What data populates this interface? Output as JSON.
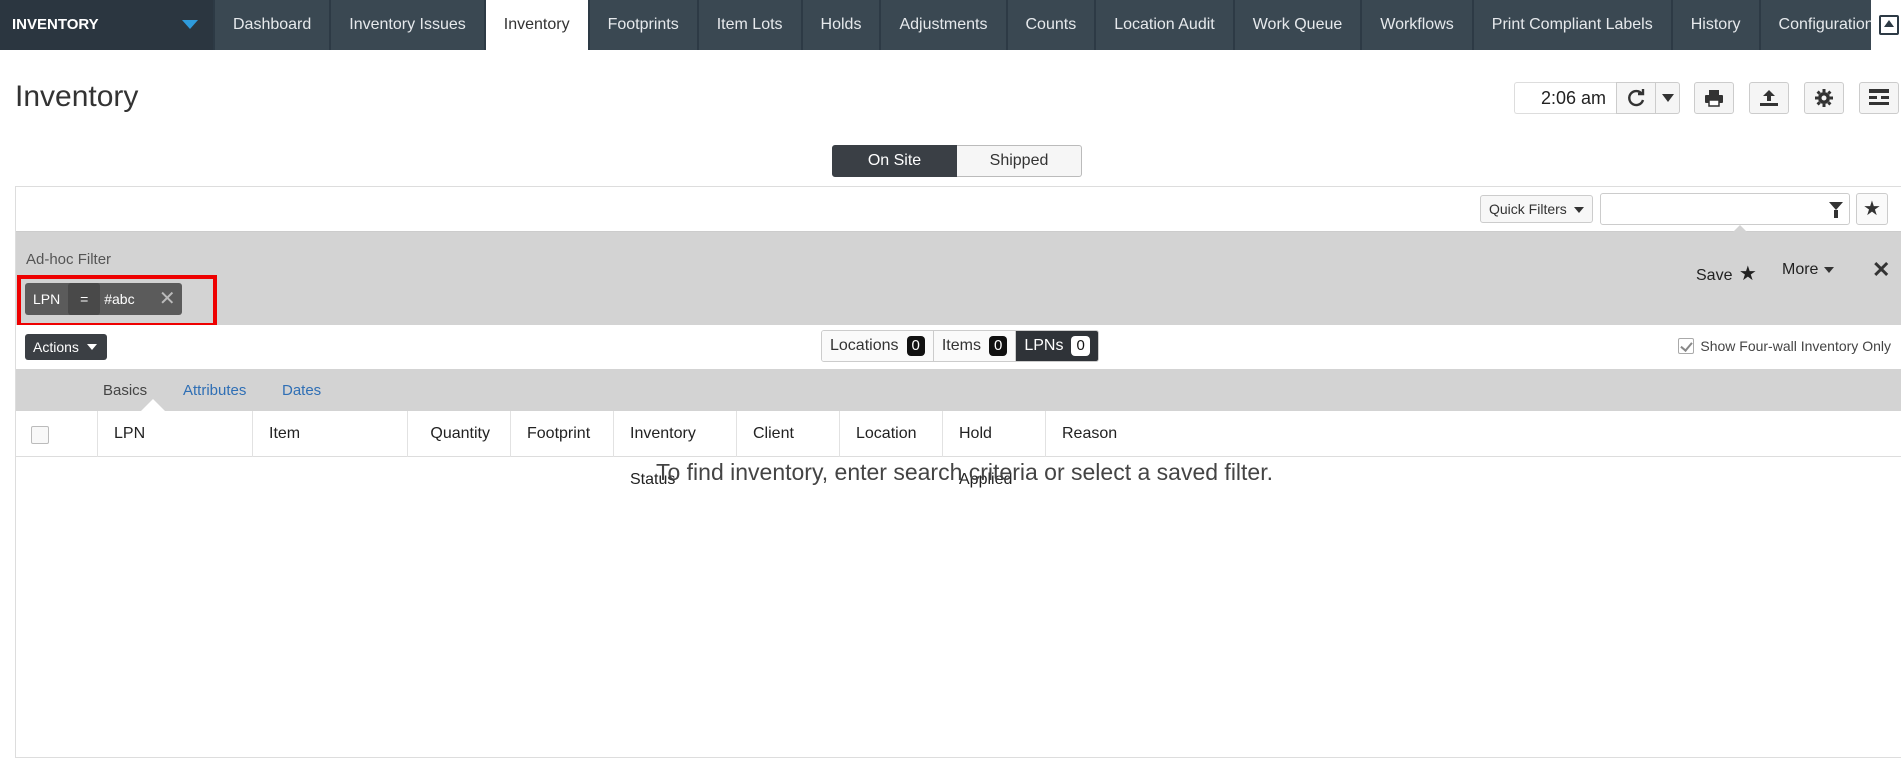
{
  "app": {
    "module_name": "INVENTORY"
  },
  "nav": {
    "tabs": [
      {
        "label": "Dashboard"
      },
      {
        "label": "Inventory Issues"
      },
      {
        "label": "Inventory"
      },
      {
        "label": "Footprints"
      },
      {
        "label": "Item Lots"
      },
      {
        "label": "Holds"
      },
      {
        "label": "Adjustments"
      },
      {
        "label": "Counts"
      },
      {
        "label": "Location Audit"
      },
      {
        "label": "Work Queue"
      },
      {
        "label": "Workflows"
      },
      {
        "label": "Print Compliant Labels"
      },
      {
        "label": "History"
      },
      {
        "label": "Configuration"
      }
    ],
    "active_tab": "Inventory",
    "more_glyph": "»"
  },
  "header": {
    "title": "Inventory",
    "time": "2:06 am"
  },
  "view_toggle": {
    "on_site": "On Site",
    "shipped": "Shipped",
    "selected": "On Site"
  },
  "filter_bar": {
    "quick_filters_label": "Quick Filters",
    "search_value": ""
  },
  "adhoc": {
    "label": "Ad-hoc Filter",
    "chip": {
      "field": "LPN",
      "operator": "=",
      "value": "#abc"
    },
    "save_label": "Save",
    "more_label": "More",
    "close_glyph": "✕"
  },
  "actions": {
    "label": "Actions",
    "counts": [
      {
        "label": "Locations",
        "value": "0"
      },
      {
        "label": "Items",
        "value": "0"
      },
      {
        "label": "LPNs",
        "value": "0"
      }
    ],
    "active_count": "LPNs",
    "fourwall_label": "Show Four-wall Inventory Only",
    "fourwall_checked": true
  },
  "subtabs": [
    {
      "label": "Basics"
    },
    {
      "label": "Attributes"
    },
    {
      "label": "Dates"
    }
  ],
  "active_subtab": "Basics",
  "columns": [
    {
      "label": "LPN"
    },
    {
      "label": "Item"
    },
    {
      "label": "Quantity"
    },
    {
      "label": "Footprint"
    },
    {
      "label": "Inventory Status"
    },
    {
      "label": "Client"
    },
    {
      "label": "Location"
    },
    {
      "label": "Hold Applied"
    },
    {
      "label": "Reason"
    }
  ],
  "empty_message": "To find inventory, enter search criteria or select a saved filter.",
  "colors": {
    "nav_bg": "#2d3a45",
    "brand_caret": "#2e9bdc",
    "highlight": "#ee0000",
    "panel_gray": "#d3d3d3",
    "link_blue": "#2f6fb5"
  }
}
